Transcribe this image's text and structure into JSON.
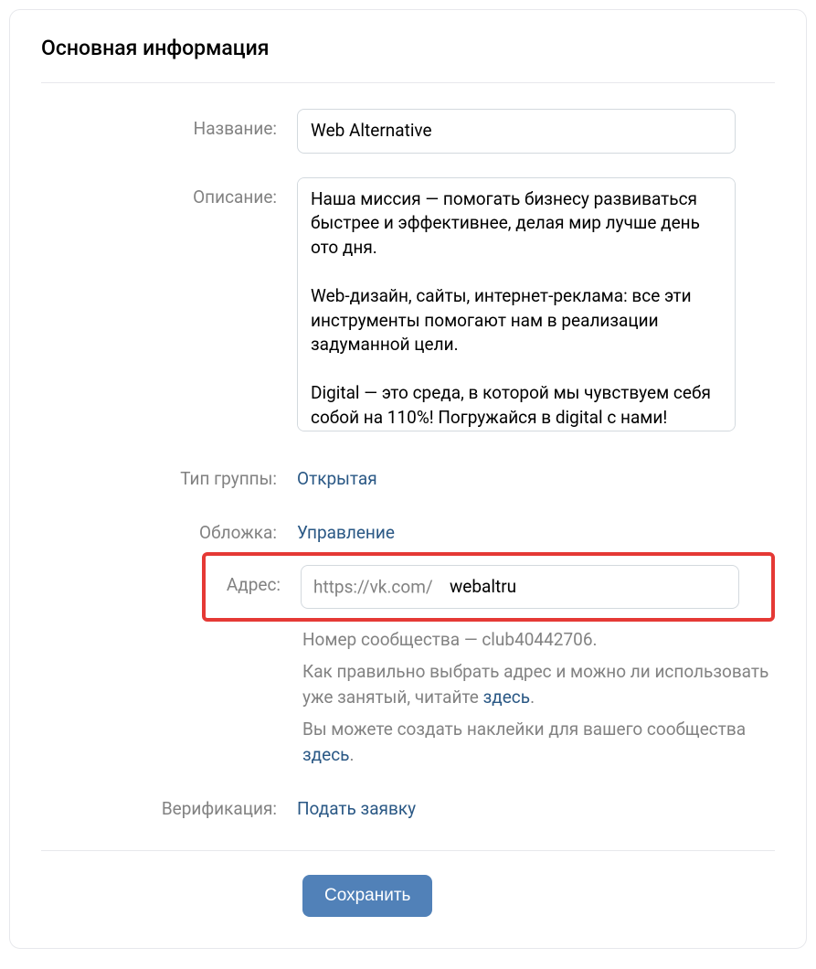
{
  "panel": {
    "title": "Основная информация"
  },
  "fields": {
    "name_label": "Название:",
    "name_value": "Web Alternative",
    "description_label": "Описание:",
    "description_value": "Наша миссия — помогать бизнесу развиваться быстрее и эффективнее, делая мир лучше день ото дня.\n\nWeb-дизайн, сайты, интернет-реклама: все эти инструменты помогают нам в реализации задуманной цели.\n\nDigital — это среда, в которой мы чувствуем себя собой на 110%! Погружайся в digital с нами!",
    "group_type_label": "Тип группы:",
    "group_type_value": "Открытая",
    "cover_label": "Обложка:",
    "cover_value": "Управление",
    "address_label": "Адрес:",
    "address_prefix": "https://vk.com/",
    "address_value": "webaltru",
    "verification_label": "Верификация:",
    "verification_value": "Подать заявку"
  },
  "hints": {
    "community_number": "Номер сообщества — club40442706.",
    "choose_address_pre": "Как правильно выбрать адрес и можно ли использовать уже занятый, читайте ",
    "choose_address_link": "здесь",
    "stickers_pre": "Вы можете создать наклейки для вашего сообщества ",
    "stickers_link": "здесь"
  },
  "actions": {
    "save": "Сохранить"
  }
}
